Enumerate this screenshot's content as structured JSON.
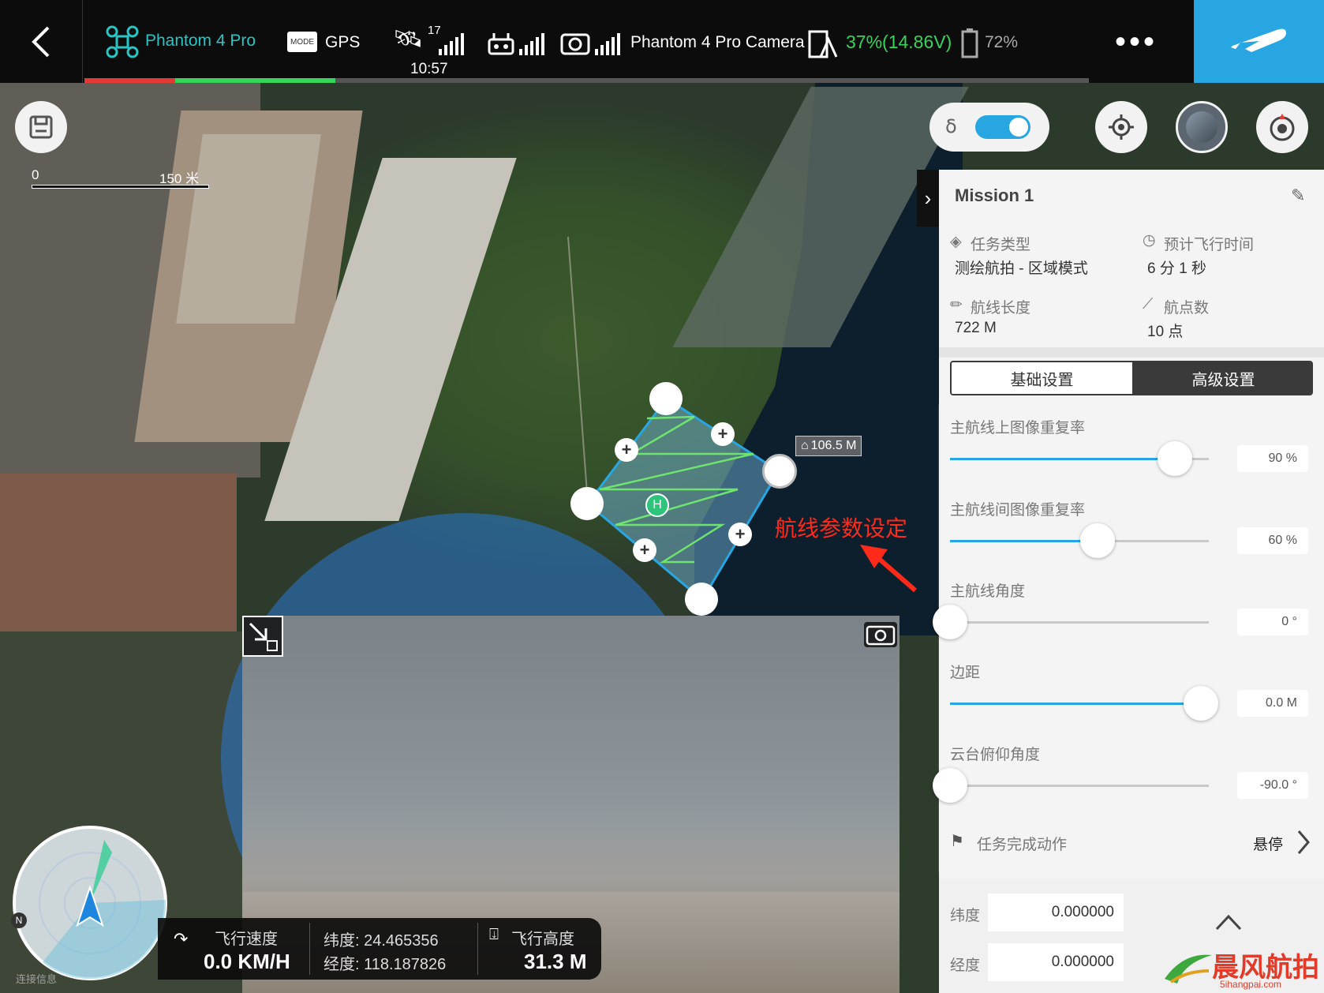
{
  "topbar": {
    "aircraft": "Phantom 4 Pro",
    "mode_icon": "MODE",
    "flight_mode": "GPS",
    "satellites": "17",
    "time": "10:57",
    "camera": "Phantom 4 Pro Camera",
    "aircraft_battery": "37%(14.86V)",
    "device_battery": "72%",
    "more": "•••",
    "progress_red": 0.09,
    "progress_green": 0.25
  },
  "map": {
    "scale_start": "0",
    "scale_end": "150 米",
    "home_distance": "106.5 M",
    "home_marker": "H",
    "annotation": "航线参数设定",
    "watermark_bottom_left": "连接信息"
  },
  "panel": {
    "collapse_icon": "›",
    "mission_name": "Mission 1",
    "task_type_label": "任务类型",
    "task_type_value": "测绘航拍 - 区域模式",
    "est_time_label": "预计飞行时间",
    "est_time_value": "6 分 1 秒",
    "route_length_label": "航线长度",
    "route_length_value": "722 M",
    "waypoints_label": "航点数",
    "waypoints_value": "10 点",
    "tab_basic": "基础设置",
    "tab_advanced": "高级设置",
    "sliders": [
      {
        "label": "主航线上图像重复率",
        "value": "90 %",
        "fraction": 0.87
      },
      {
        "label": "主航线间图像重复率",
        "value": "60 %",
        "fraction": 0.57
      },
      {
        "label": "主航线角度",
        "value": "0 °",
        "fraction": 0.0
      },
      {
        "label": "边距",
        "value": "0.0 M",
        "fraction": 0.97
      },
      {
        "label": "云台俯仰角度",
        "value": "-90.0 °",
        "fraction": 0.0
      }
    ],
    "finish_action_label": "任务完成动作",
    "finish_action_value": "悬停",
    "lat_label": "纬度",
    "lat_value": "0.000000",
    "lng_label": "经度",
    "lng_value": "0.000000"
  },
  "telemetry": {
    "speed_label": "飞行速度",
    "speed_value": "0.0 KM/H",
    "lat": "纬度: 24.465356",
    "lng": "经度: 118.187826",
    "alt_label": "飞行高度",
    "alt_value": "31.3 M"
  },
  "radar": {
    "north": "N"
  },
  "watermark": {
    "logo_text": "晨风航拍",
    "url": "5ihangpai.com"
  },
  "colors": {
    "accent": "#27a6e2",
    "highlight": "#ff2a1a",
    "battery_green": "#35d45a"
  }
}
